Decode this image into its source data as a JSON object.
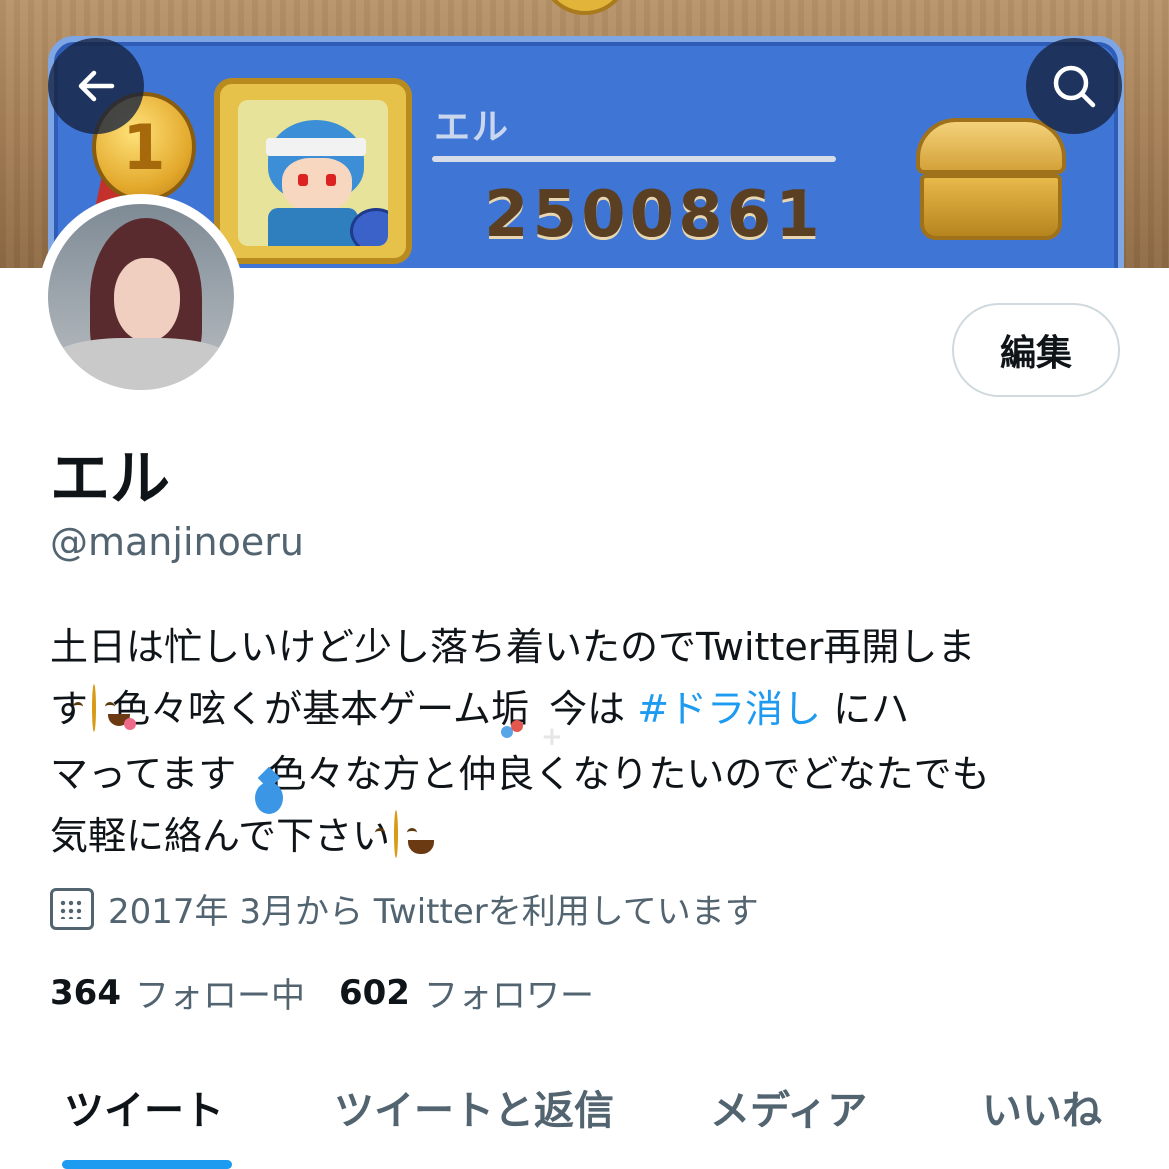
{
  "banner": {
    "player_name": "エル",
    "score": "2500861",
    "rank": "1"
  },
  "header": {
    "back_icon": "back-arrow-icon",
    "search_icon": "search-icon"
  },
  "profile": {
    "edit_label": "編集",
    "display_name": "エル",
    "handle": "@manjinoeru",
    "bio": {
      "line1": "土日は忙しいけど少し落ち着いたのでTwitter再開しま",
      "line2_a": "す",
      "line2_b": "色々呟くが基本ゲーム垢",
      "line2_c": "今は",
      "line2_hashtag": "#ドラ消し",
      "line2_d": "にハ",
      "line3_a": "マってます",
      "line3_b": "色々な方と仲良くなりたいのでどなたでも",
      "line4": "気軽に絡んで下さい"
    },
    "joined": "2017年 3月から Twitterを利用しています",
    "following_count": "364",
    "following_label": "フォロー中",
    "followers_count": "602",
    "followers_label": "フォロワー"
  },
  "tabs": [
    {
      "label": "ツイート",
      "active": true
    },
    {
      "label": "ツイートと返信",
      "active": false
    },
    {
      "label": "メディア",
      "active": false
    },
    {
      "label": "いいね",
      "active": false
    }
  ],
  "colors": {
    "accent": "#1d9bf0",
    "text_primary": "#0f1419",
    "text_secondary": "#536471"
  }
}
